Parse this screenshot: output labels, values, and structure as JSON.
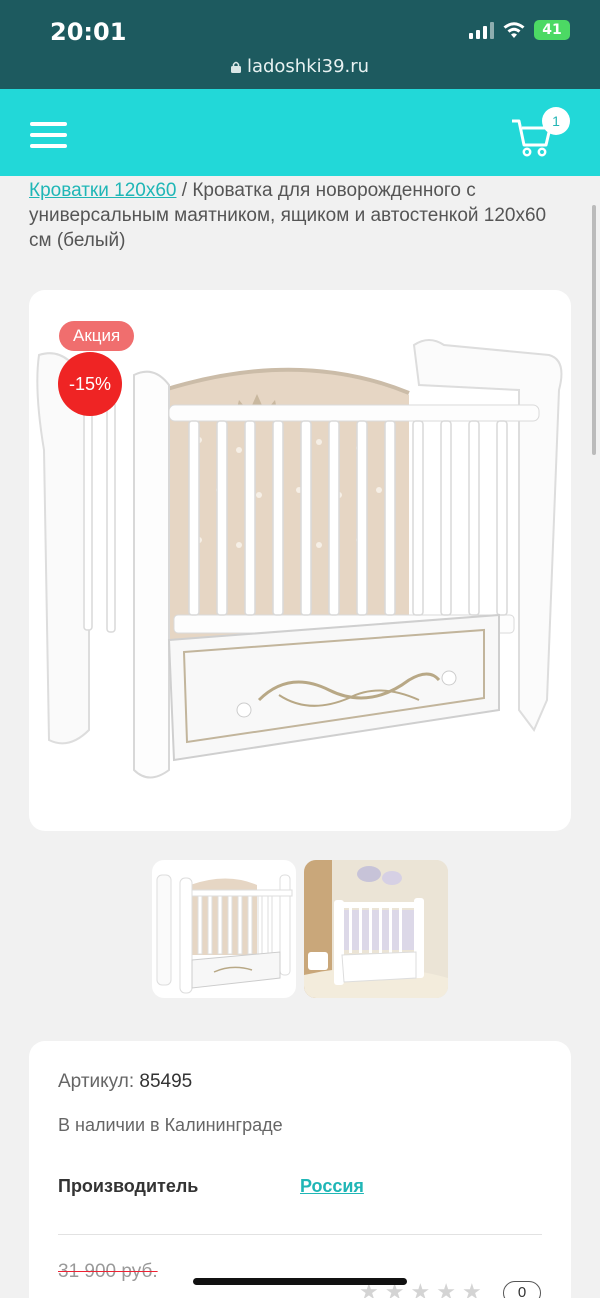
{
  "status": {
    "time": "20:01",
    "battery": "41",
    "url": "ladoshki39.ru"
  },
  "header": {
    "cart_count": "1"
  },
  "breadcrumb": {
    "link": "Кроватки 120х60",
    "separator": " / ",
    "current": "Кроватка для новорожденного с универсальным маятником, ящиком и автостенкой 120х60 см (белый)"
  },
  "product": {
    "badge_sale": "Акция",
    "badge_discount": "-15%",
    "sku_label": "Артикул:",
    "sku_value": "85495",
    "stock": "В наличии в Калининграде",
    "maker_label": "Производитель",
    "maker_value": "Россия",
    "old_price": "31 900 руб.",
    "rating_count": "0"
  },
  "icons": {
    "menu": "menu-icon",
    "cart": "cart-icon",
    "lock": "lock-icon",
    "star": "star-icon"
  },
  "colors": {
    "header_bg": "#22d8d8",
    "status_bg": "#1d5a5f",
    "accent_link": "#1fb6b6",
    "sale_badge": "#f06e6e",
    "discount_badge": "#ef2424"
  }
}
